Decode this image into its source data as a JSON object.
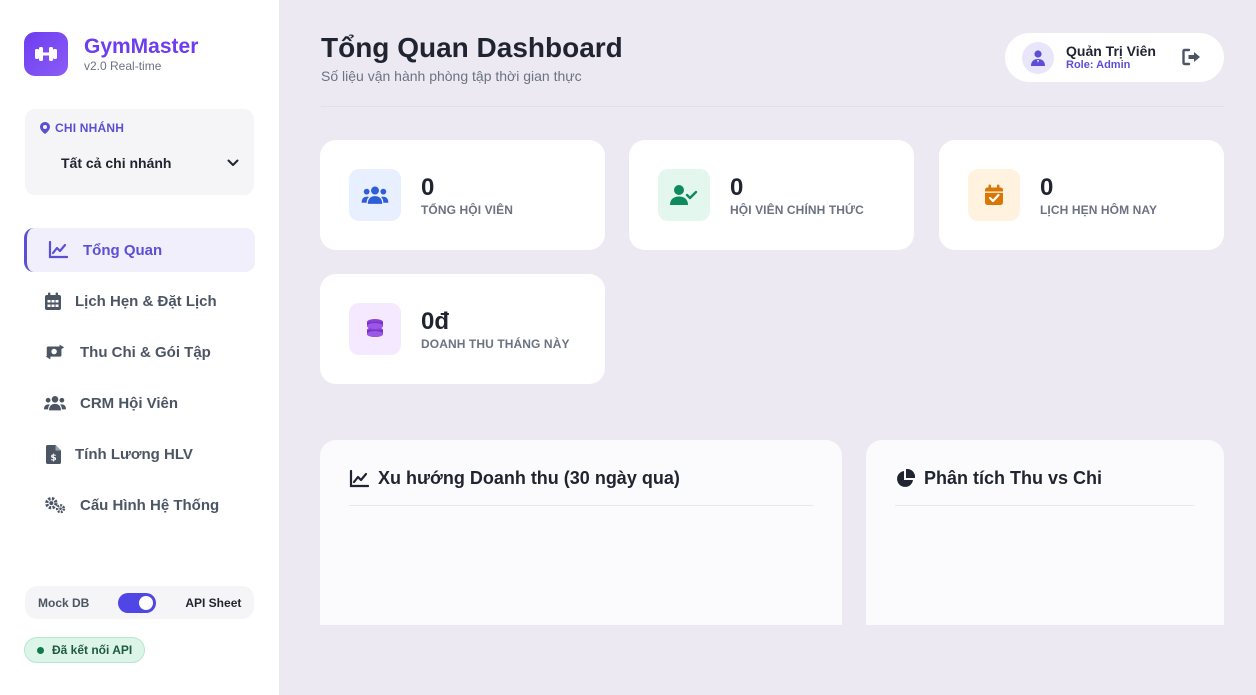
{
  "brand": {
    "title": "GymMaster",
    "subtitle": "v2.0 Real-time"
  },
  "branch": {
    "label": "CHI NHÁNH",
    "selected": "Tất cả chi nhánh"
  },
  "nav": [
    {
      "label": "Tổng Quan",
      "icon": "chart-line-icon",
      "active": true
    },
    {
      "label": "Lịch Hẹn & Đặt Lịch",
      "icon": "calendar-icon"
    },
    {
      "label": "Thu Chi & Gói Tập",
      "icon": "money-exchange-icon"
    },
    {
      "label": "CRM Hội Viên",
      "icon": "users-icon"
    },
    {
      "label": "Tính Lương HLV",
      "icon": "invoice-dollar-icon"
    },
    {
      "label": "Cấu Hình Hệ Thống",
      "icon": "cogs-icon"
    }
  ],
  "toggle": {
    "left": "Mock DB",
    "right": "API Sheet",
    "on": true
  },
  "api_status": "Đã kết nối API",
  "header": {
    "title": "Tổng Quan Dashboard",
    "subtitle": "Số liệu vận hành phòng tập thời gian thực"
  },
  "user": {
    "name": "Quản Trị Viên",
    "role": "Role: Admin"
  },
  "stats": [
    {
      "value": "0",
      "label": "TỔNG HỘI VIÊN",
      "icon": "users-icon",
      "color": "#2f5fd8",
      "bg": "#e8efff"
    },
    {
      "value": "0",
      "label": "HỘI VIÊN CHÍNH THỨC",
      "icon": "user-check-icon",
      "color": "#0f8a5f",
      "bg": "#e3f7ee"
    },
    {
      "value": "0",
      "label": "LỊCH HẸN HÔM NAY",
      "icon": "calendar-check-icon",
      "color": "#d97706",
      "bg": "#fff3df"
    },
    {
      "value": "0đ",
      "label": "DOANH THU THÁNG NÀY",
      "icon": "coins-icon",
      "color": "#8b3fd9",
      "bg": "#f5e9ff"
    }
  ],
  "panels": {
    "revenue_title": "Xu hướng Doanh thu (30 ngày qua)",
    "analysis_title": "Phân tích Thu vs Chi"
  }
}
